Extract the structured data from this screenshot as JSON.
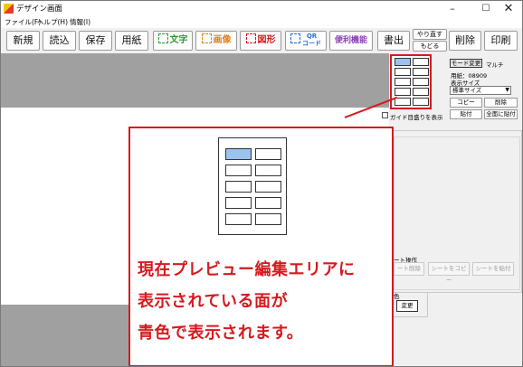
{
  "window": {
    "title": "デザイン画面"
  },
  "window_controls": {
    "minimize": "–",
    "maximize": "☐",
    "close": "✕"
  },
  "menu": [
    "ファイル(F)",
    "ヘルプ(H)",
    "情報(I)"
  ],
  "toolbar": {
    "new": "新規",
    "open": "読込",
    "save": "保存",
    "paper": "用紙",
    "text": "文字",
    "image": "画像",
    "shape": "図形",
    "qr_line1": "QR",
    "qr_line2": "コード",
    "util": "便利機能",
    "print_out": "書出",
    "redo": "やり直す",
    "undo": "もどる",
    "delete": "削除",
    "print": "印刷"
  },
  "right_panel": {
    "mode_button": "モード変更",
    "mode_value": "マルチ",
    "paper_code": "用紙：08909",
    "display_size_label": "表示サイズ",
    "display_size_value": "標準サイズ",
    "copy": "コピー",
    "erase": "削除",
    "paste": "貼付",
    "paste_all": "全面に貼付",
    "guide_checkbox": "ガイド目盛りを表示",
    "sheet_ops_label": "ート操作",
    "sheet_delete": "ート削除",
    "sheet_copy": "シートをコピー",
    "sheet_paste": "シートを貼付",
    "color_label": "色",
    "color_change": "変更"
  },
  "callout": {
    "line1": "現在プレビュー編集エリアに",
    "line2": "表示されている面が",
    "line3": "青色で表示されます。"
  },
  "colors": {
    "accent_red": "#d7191e",
    "active_blue": "#9cc3f0",
    "preview_gray": "#a0a0a0"
  }
}
